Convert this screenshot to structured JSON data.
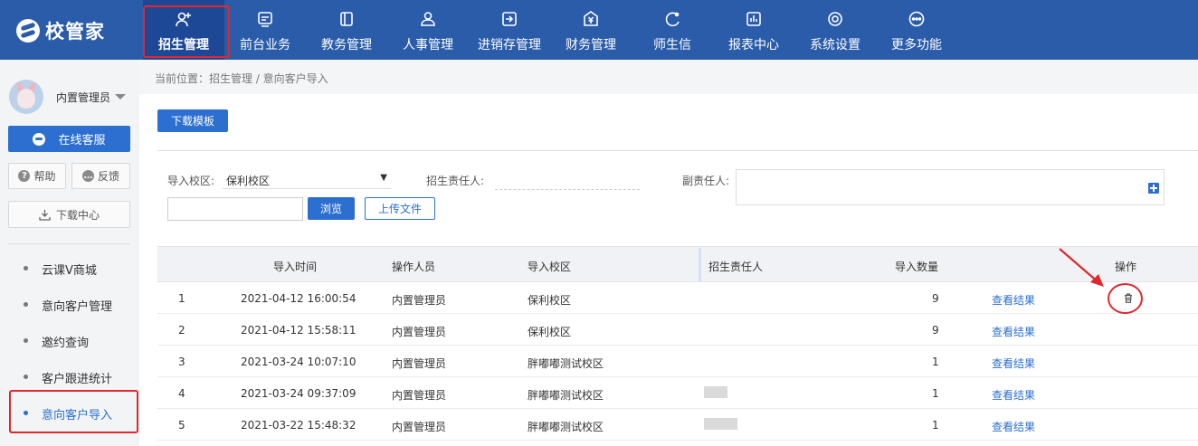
{
  "app": {
    "logo_text": "校管家"
  },
  "nav": {
    "items": [
      {
        "label": "招生管理",
        "icon": "user-plus-icon"
      },
      {
        "label": "前台业务",
        "icon": "screen-icon"
      },
      {
        "label": "教务管理",
        "icon": "book-icon"
      },
      {
        "label": "人事管理",
        "icon": "person-icon"
      },
      {
        "label": "进销存管理",
        "icon": "inventory-icon"
      },
      {
        "label": "财务管理",
        "icon": "yen-icon"
      },
      {
        "label": "师生信",
        "icon": "chat-icon"
      },
      {
        "label": "报表中心",
        "icon": "report-icon"
      },
      {
        "label": "系统设置",
        "icon": "settings-icon"
      },
      {
        "label": "更多功能",
        "icon": "more-icon"
      }
    ],
    "active_index": 0
  },
  "sidebar": {
    "user_name": "内置管理员",
    "service_label": "在线客服",
    "help_label": "帮助",
    "feedback_label": "反馈",
    "download_label": "下载中心",
    "menu": [
      {
        "label": "云课V商城"
      },
      {
        "label": "意向客户管理"
      },
      {
        "label": "邀约查询"
      },
      {
        "label": "客户跟进统计"
      },
      {
        "label": "意向客户导入"
      }
    ],
    "active_menu_index": 4
  },
  "breadcrumb": "当前位置：招生管理 / 意向客户导入",
  "toolbar": {
    "download_template_label": "下载模板"
  },
  "form": {
    "campus_label": "导入校区:",
    "campus_value": "保利校区",
    "responsible_label": "招生责任人:",
    "deputy_label": "副责任人:",
    "browse_label": "浏览",
    "upload_label": "上传文件"
  },
  "table": {
    "headers": [
      "导入时间",
      "操作人员",
      "导入校区",
      "招生责任人",
      "导入数量",
      "操作"
    ],
    "rows": [
      {
        "no": "1",
        "time": "2021-04-12 16:00:54",
        "operator": "内置管理员",
        "campus": "保利校区",
        "responsible": "",
        "count": "9",
        "action": "查看结果",
        "has_delete": true
      },
      {
        "no": "2",
        "time": "2021-04-12 15:58:11",
        "operator": "内置管理员",
        "campus": "保利校区",
        "responsible": "",
        "count": "9",
        "action": "查看结果",
        "has_delete": false
      },
      {
        "no": "3",
        "time": "2021-03-24 10:07:10",
        "operator": "内置管理员",
        "campus": "胖嘟嘟测试校区",
        "responsible": "",
        "count": "1",
        "action": "查看结果",
        "has_delete": false
      },
      {
        "no": "4",
        "time": "2021-03-24 09:37:09",
        "operator": "内置管理员",
        "campus": "胖嘟嘟测试校区",
        "responsible": "",
        "count": "1",
        "action": "查看结果",
        "has_delete": false
      },
      {
        "no": "5",
        "time": "2021-03-22 15:48:32",
        "operator": "内置管理员",
        "campus": "胖嘟嘟测试校区",
        "responsible": "",
        "count": "1",
        "action": "查看结果",
        "has_delete": false
      }
    ]
  },
  "colors": {
    "brand": "#2a5caa",
    "accent": "#2c6fd0",
    "highlight": "#e0282e"
  }
}
